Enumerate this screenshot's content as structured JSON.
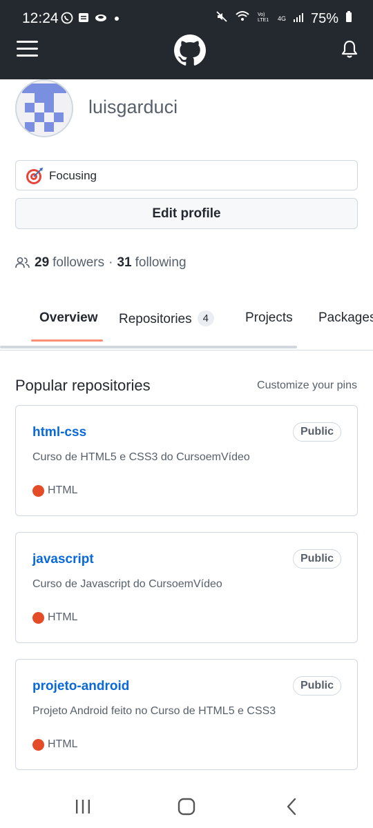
{
  "status_bar": {
    "time": "12:24",
    "battery": "75%",
    "network_label": "4G"
  },
  "header": {
    "menu_icon": "hamburger-menu-icon",
    "logo_icon": "github-logo-icon",
    "bell_icon": "bell-icon"
  },
  "profile": {
    "username": "luisgarduci",
    "status_text": "Focusing",
    "status_icon": "target-icon",
    "edit_button": "Edit profile",
    "followers_count": "29",
    "followers_label": "followers",
    "separator": "·",
    "following_count": "31",
    "following_label": "following"
  },
  "tabs": [
    {
      "label": "Overview",
      "active": true
    },
    {
      "label": "Repositories",
      "count": "4"
    },
    {
      "label": "Projects"
    },
    {
      "label": "Packages"
    }
  ],
  "popular": {
    "title": "Popular repositories",
    "customize": "Customize your pins",
    "repos": [
      {
        "name": "html-css",
        "visibility": "Public",
        "description": "Curso de HTML5 e CSS3 do CursoemVídeo",
        "language": "HTML",
        "language_color": "#e34c26"
      },
      {
        "name": "javascript",
        "visibility": "Public",
        "description": "Curso de Javascript do CursoemVídeo",
        "language": "HTML",
        "language_color": "#e34c26"
      },
      {
        "name": "projeto-android",
        "visibility": "Public",
        "description": "Projeto Android feito no Curso de HTML5 e CSS3",
        "language": "HTML",
        "language_color": "#e34c26"
      }
    ]
  },
  "colors": {
    "header_bg": "#24292f",
    "link": "#0969da",
    "tab_underline": "#fd8c73"
  }
}
